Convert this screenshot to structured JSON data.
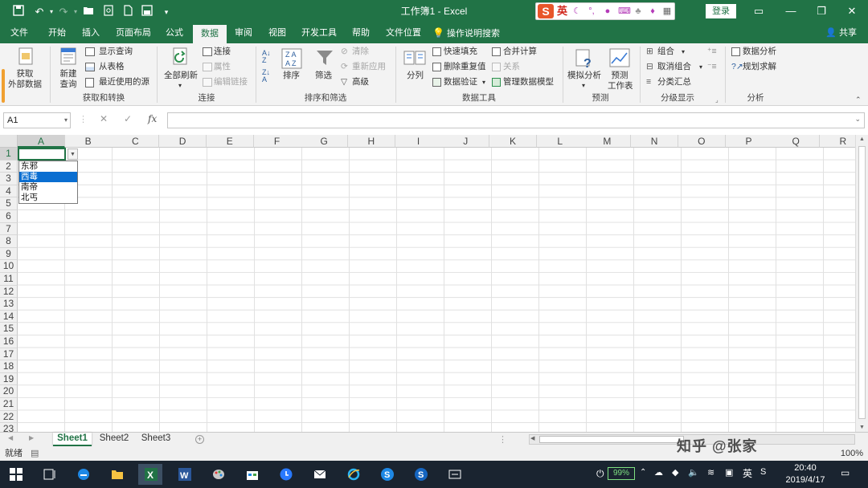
{
  "window": {
    "title": "工作簿1  -  Excel",
    "login_label": "登录"
  },
  "ime": {
    "mode": "英"
  },
  "tabs": [
    "文件",
    "开始",
    "插入",
    "页面布局",
    "公式",
    "数据",
    "审阅",
    "视图",
    "开发工具",
    "帮助",
    "文件位置",
    "操作说明搜索"
  ],
  "active_tab": "数据",
  "share_label": "共享",
  "ribbon": {
    "get_external": "获取\n外部数据",
    "new_query": "新建\n查询",
    "show_query": "显示查询",
    "from_table": "从表格",
    "recent_sources": "最近使用的源",
    "group_get_transform": "获取和转换",
    "refresh_all": "全部刷新",
    "connections": "连接",
    "properties": "属性",
    "edit_links": "编辑链接",
    "group_connections": "连接",
    "sort_az": "A↓Z",
    "sort": "排序",
    "filter": "筛选",
    "clear": "清除",
    "reapply": "重新应用",
    "advanced": "高级",
    "group_sort_filter": "排序和筛选",
    "text_to_columns": "分列",
    "flash_fill": "快速填充",
    "remove_duplicates": "删除重复值",
    "data_validation": "数据验证",
    "consolidate": "合并计算",
    "relationships": "关系",
    "data_model": "管理数据模型",
    "group_data_tools": "数据工具",
    "what_if": "模拟分析",
    "forecast_sheet": "预测\n工作表",
    "group_forecast": "预测",
    "group": "组合",
    "ungroup": "取消组合",
    "subtotal": "分类汇总",
    "group_outline": "分级显示",
    "data_analysis": "数据分析",
    "solver": "规划求解",
    "group_analysis": "分析"
  },
  "formula_bar": {
    "name_box": "A1",
    "formula": "",
    "fx": "fx"
  },
  "columns": [
    "A",
    "B",
    "C",
    "D",
    "E",
    "F",
    "G",
    "H",
    "I",
    "J",
    "K",
    "L",
    "M",
    "N",
    "O",
    "P",
    "Q",
    "R"
  ],
  "rows": [
    "1",
    "2",
    "3",
    "4",
    "5",
    "6",
    "7",
    "8",
    "9",
    "10",
    "11",
    "12",
    "13",
    "14",
    "15",
    "16",
    "17",
    "18",
    "19",
    "20",
    "21",
    "22",
    "23"
  ],
  "dropdown": {
    "items": [
      "东邪",
      "西毒",
      "南帝",
      "北丐"
    ],
    "highlighted_index": 1
  },
  "sheets": [
    "Sheet1",
    "Sheet2",
    "Sheet3"
  ],
  "active_sheet": "Sheet1",
  "status": {
    "mode": "就绪",
    "zoom": "100%"
  },
  "watermark": "知乎 @张家",
  "taskbar": {
    "battery": "99%",
    "time": "20:40",
    "date": "2019/4/17",
    "ime": "英"
  }
}
